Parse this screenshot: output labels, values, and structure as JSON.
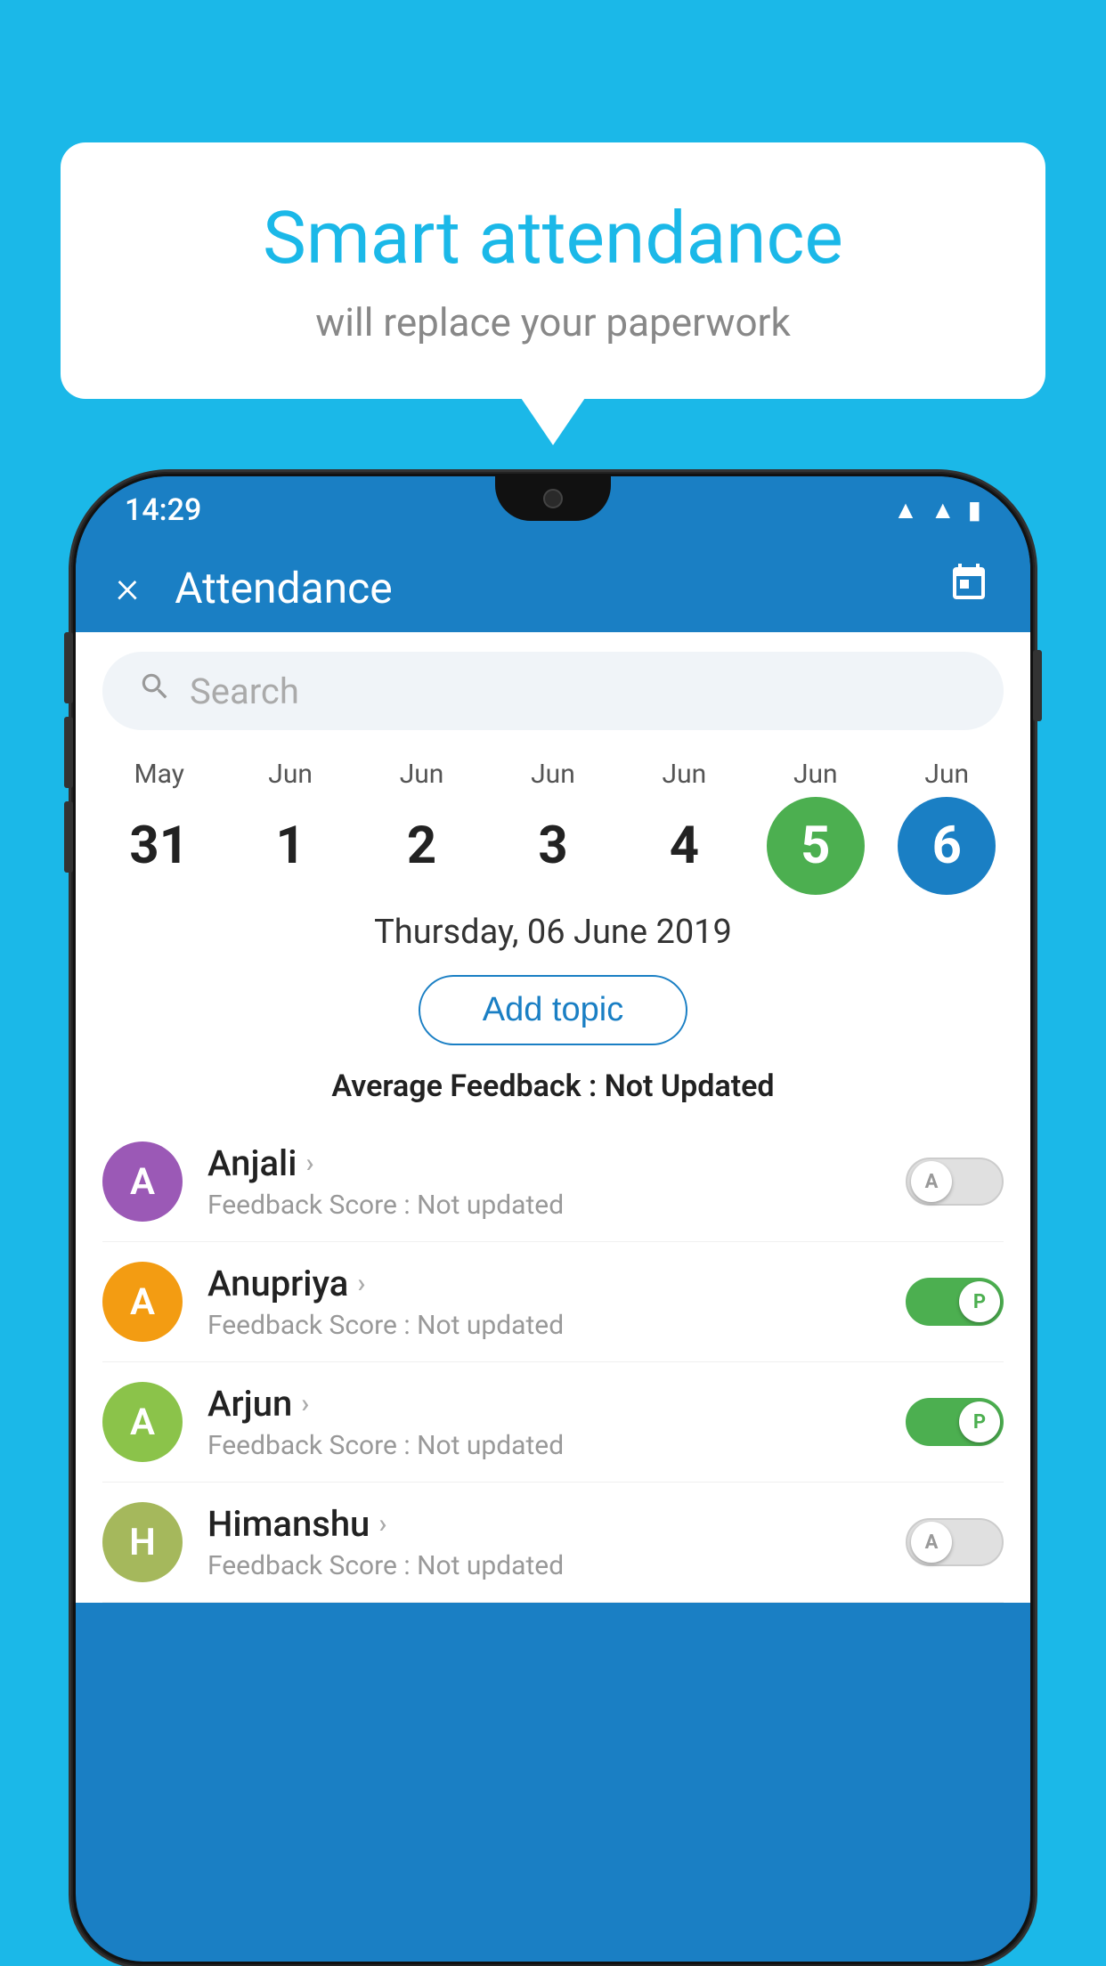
{
  "background_color": "#1bb8e8",
  "bubble": {
    "title": "Smart attendance",
    "subtitle": "will replace your paperwork"
  },
  "phone": {
    "status_bar": {
      "time": "14:29",
      "icons": [
        "wifi",
        "signal",
        "battery"
      ]
    },
    "header": {
      "title": "Attendance",
      "close_label": "×",
      "calendar_icon": "📅"
    },
    "search": {
      "placeholder": "Search"
    },
    "calendar": {
      "days": [
        {
          "month": "May",
          "date": "31",
          "state": "normal"
        },
        {
          "month": "Jun",
          "date": "1",
          "state": "normal"
        },
        {
          "month": "Jun",
          "date": "2",
          "state": "normal"
        },
        {
          "month": "Jun",
          "date": "3",
          "state": "normal"
        },
        {
          "month": "Jun",
          "date": "4",
          "state": "normal"
        },
        {
          "month": "Jun",
          "date": "5",
          "state": "today"
        },
        {
          "month": "Jun",
          "date": "6",
          "state": "selected"
        }
      ]
    },
    "selected_date": "Thursday, 06 June 2019",
    "add_topic_label": "Add topic",
    "avg_feedback_label": "Average Feedback :",
    "avg_feedback_value": "Not Updated",
    "students": [
      {
        "name": "Anjali",
        "avatar_letter": "A",
        "avatar_color": "purple",
        "feedback": "Not updated",
        "toggle_state": "off",
        "toggle_letter": "A"
      },
      {
        "name": "Anupriya",
        "avatar_letter": "A",
        "avatar_color": "yellow",
        "feedback": "Not updated",
        "toggle_state": "on",
        "toggle_letter": "P"
      },
      {
        "name": "Arjun",
        "avatar_letter": "A",
        "avatar_color": "light-green",
        "feedback": "Not updated",
        "toggle_state": "on",
        "toggle_letter": "P"
      },
      {
        "name": "Himanshu",
        "avatar_letter": "H",
        "avatar_color": "khaki",
        "feedback": "Not updated",
        "toggle_state": "off",
        "toggle_letter": "A"
      }
    ],
    "feedback_score_label": "Feedback Score : "
  }
}
